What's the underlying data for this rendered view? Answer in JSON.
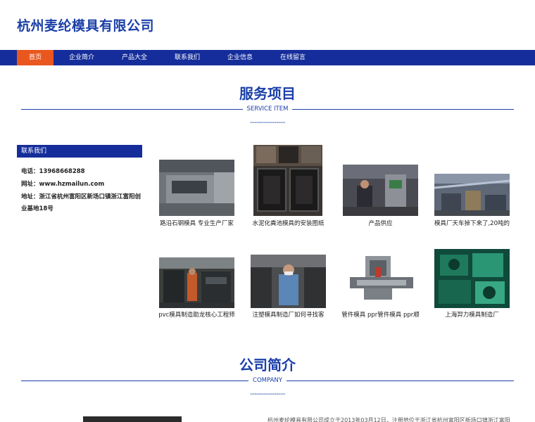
{
  "site": {
    "title": "杭州麦纶模具有限公司"
  },
  "nav": {
    "items": [
      {
        "label": "首页",
        "active": true
      },
      {
        "label": "企业简介"
      },
      {
        "label": "产品大全"
      },
      {
        "label": "联系我们"
      },
      {
        "label": "企业信息"
      },
      {
        "label": "在线留言"
      }
    ]
  },
  "services": {
    "title": "服务项目",
    "subtitle": "SERVICE ITEM",
    "dash": "----------------"
  },
  "contact": {
    "header": "联系我们",
    "phone": "电话：13968668288",
    "website": "网址：www.hzmailun.com",
    "address_line1": "地址：浙江省杭州富阳区新场口镇浙江富阳创",
    "address_line2": "业基地18号"
  },
  "products": [
    {
      "caption": "路沿石钢模具 专业生产厂家",
      "icon": "steel-mold-photo"
    },
    {
      "caption": "水泥化粪池模具的安装图纸",
      "icon": "septic-tank-mold-photo"
    },
    {
      "caption": "产品供应",
      "icon": "factory-worker-photo"
    },
    {
      "caption": "模具厂天车掉下来了,20吨的",
      "icon": "crane-workshop-photo"
    },
    {
      "caption": "pvc模具制造助龙核心工程师",
      "icon": "pvc-workshop-photo"
    },
    {
      "caption": "注塑模具制造厂如何寻找客",
      "icon": "injection-worker-photo"
    },
    {
      "caption": "管件模具 ppr管件模具 ppr顺",
      "icon": "pipe-fitting-mold-photo"
    },
    {
      "caption": "上海羿力模具制造厂",
      "icon": "green-mold-photo"
    }
  ],
  "company": {
    "title": "公司简介",
    "subtitle": "COMPANY",
    "dash": "----------------",
    "intro": "杭州麦纶模具有限公司成立于2013年03月12日，注册地位于浙江省杭州富阳区新场口镇浙江富阳"
  },
  "colors": {
    "brand_blue": "#152d9b",
    "title_blue": "#1a3fa8",
    "active_orange": "#e9571f"
  }
}
